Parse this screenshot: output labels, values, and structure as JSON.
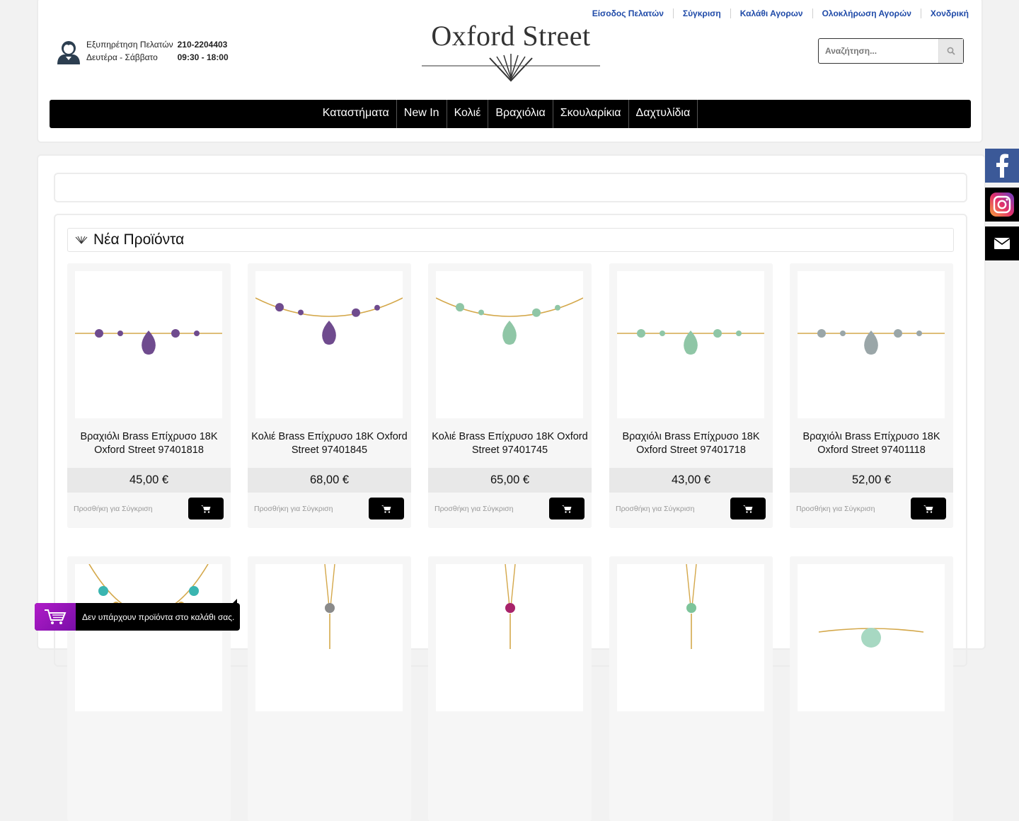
{
  "top_links": [
    "Είσοδος Πελατών",
    "Σύγκριση",
    "Καλάθι Αγορων",
    "Ολοκλήρωση Αγορών",
    "Χονδρική"
  ],
  "support": {
    "label1": "Εξυπηρέτηση Πελατών",
    "phone": "210-2204403",
    "label2": "Δευτέρα - Σάββατο",
    "hours": "09:30 - 18:00",
    "icon": "customer-support-icon"
  },
  "logo": {
    "name": "Oxford Street",
    "icon": "diamond-logo-icon"
  },
  "search": {
    "placeholder": "Αναζήτηση...",
    "icon": "search-icon"
  },
  "nav": [
    "Καταστήματα",
    "New In",
    "Κολιέ",
    "Βραχιόλια",
    "Σκουλαρίκια",
    "Δαχτυλίδια"
  ],
  "section": {
    "title": "Νέα Προϊόντα",
    "icon": "diamond-icon"
  },
  "products": [
    {
      "title": "Βραχιόλι Brass Επίχρυσο 18K Oxford Street 97401818",
      "price": "45,00 €",
      "compare": "Προσθήκη για Σύγκριση",
      "stone": "#6f4b8e"
    },
    {
      "title": "Κολιέ Brass Επίχρυσο 18K Oxford Street 97401845",
      "price": "68,00 €",
      "compare": "Προσθήκη για Σύγκριση",
      "stone": "#6f4b8e"
    },
    {
      "title": "Κολιέ Brass Επίχρυσο 18K Oxford Street 97401745",
      "price": "65,00 €",
      "compare": "Προσθήκη για Σύγκριση",
      "stone": "#8fc6a6"
    },
    {
      "title": "Βραχιόλι Brass Επίχρυσο 18K Oxford Street 97401718",
      "price": "43,00 €",
      "compare": "Προσθήκη για Σύγκριση",
      "stone": "#8fc6a6"
    },
    {
      "title": "Βραχιόλι Brass Επίχρυσο 18K Oxford Street 97401118",
      "price": "52,00 €",
      "compare": "Προσθήκη για Σύγκριση",
      "stone": "#9aa6a8"
    }
  ],
  "social": [
    "facebook-icon",
    "instagram-icon",
    "email-icon"
  ],
  "mini_cart": {
    "text": "Δεν υπάρχουν προϊόντα στο καλάθι σας.",
    "icon": "shopping-cart-icon"
  },
  "colors": {
    "link": "#1f4aa8",
    "nav_bg": "#000000",
    "facebook": "#3b5998"
  }
}
